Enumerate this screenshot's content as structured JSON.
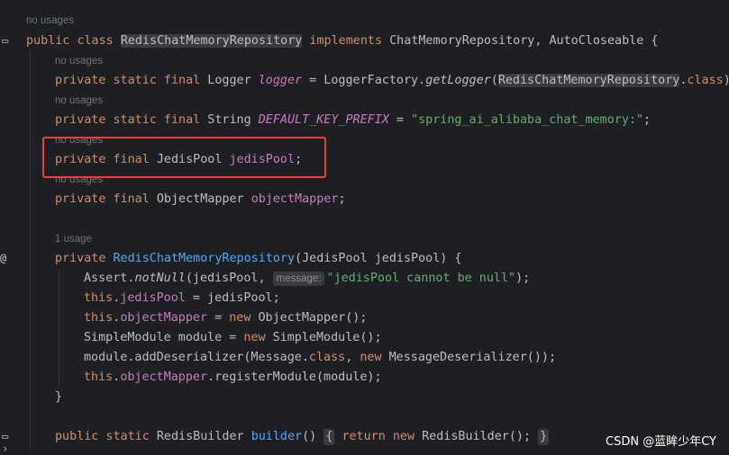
{
  "hints": {
    "h1": "no usages",
    "h2": "no usages",
    "h3": "no usages",
    "h4": "no usages",
    "h5": "no usages",
    "h6": "1 usage"
  },
  "code": {
    "class_decl": {
      "kw_public": "public",
      "kw_class": "class",
      "name": "RedisChatMemoryRepository",
      "kw_implements": "implements",
      "rest": " ChatMemoryRepository, AutoCloseable {"
    },
    "logger_line": {
      "mods": "private static final",
      "type": " Logger ",
      "name": "logger",
      "eq": " = LoggerFactory.",
      "method": "getLogger",
      "open": "(",
      "arg": "RedisChatMemoryRepository",
      "dot": ".",
      "kw_class": "class",
      "close": ");"
    },
    "prefix_line": {
      "mods": "private static final",
      "type": " String ",
      "name": "DEFAULT_KEY_PREFIX",
      "eq": " = ",
      "value": "\"spring_ai_alibaba_chat_memory:\"",
      "end": ";"
    },
    "pool_line": {
      "mods": "private final",
      "type": " JedisPool ",
      "name": "jedisPool",
      "end": ";"
    },
    "mapper_line": {
      "mods": "private final",
      "type": " ObjectMapper ",
      "name": "objectMapper",
      "end": ";"
    },
    "ctor_line": {
      "kw": "private",
      "name": "RedisChatMemoryRepository",
      "params": "(JedisPool jedisPool) {"
    },
    "assert_line": {
      "pre": "Assert.",
      "method": "notNull",
      "args": "(jedisPool, ",
      "hint": "message:",
      "value": "\"jedisPool cannot be null\"",
      "end": ");"
    },
    "assign1": {
      "kw": "this",
      "dot": ".",
      "field": "jedisPool",
      "rest": " = jedisPool;"
    },
    "assign2": {
      "kw": "this",
      "dot": ".",
      "field": "objectMapper",
      "eq": " = ",
      "kw_new": "new",
      "rest": " ObjectMapper();"
    },
    "module_line": {
      "pre": "SimpleModule module = ",
      "kw_new": "new",
      "rest": " SimpleModule();"
    },
    "deser_line": {
      "pre": "module.addDeserializer(Message.",
      "kw_class": "class",
      "mid": ", ",
      "kw_new": "new",
      "rest": " MessageDeserializer());"
    },
    "register_line": {
      "kw": "this",
      "dot": ".",
      "field": "objectMapper",
      "rest": ".registerModule(module);"
    },
    "close_brace": "}",
    "builder_line": {
      "mods": "public static",
      "type": " RedisBuilder ",
      "method": "builder",
      "paren": "() ",
      "open_brace": "{",
      "kw_return": "return",
      "space": " ",
      "kw_new": "new",
      "rest": " RedisBuilder(); ",
      "close_brace": "}"
    }
  },
  "gutter": {
    "class_icon": "▭",
    "ctor_icon": "@",
    "builder_icon": "▭ ›"
  },
  "watermark": "CSDN @蓝眸少年CY"
}
